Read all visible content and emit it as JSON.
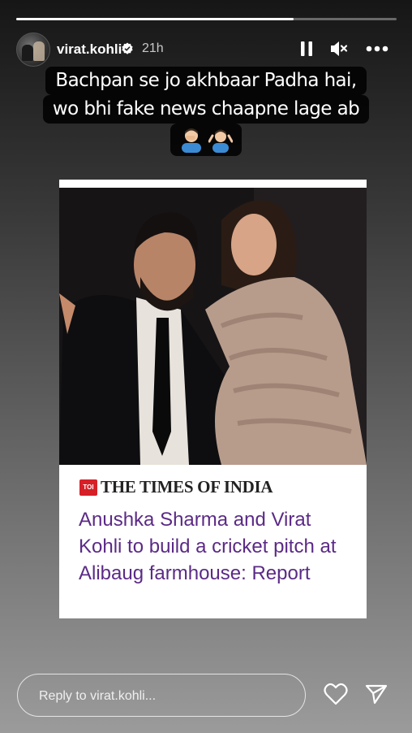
{
  "progress": {
    "viewed_fraction": 0.73
  },
  "header": {
    "username": "virat.kohli",
    "time": "21h",
    "icons": {
      "pause": "pause-icon",
      "mute": "muted-speaker-icon",
      "more": "more-dots-icon",
      "verified": "verified-badge-icon"
    }
  },
  "caption": {
    "line1": "Bachpan se jo akhbaar Padha hai,",
    "line2": "wo bhi fake news chaapne lage ab",
    "emojis": [
      "man-facepalming-emoji",
      "man-shrugging-emoji"
    ]
  },
  "card": {
    "logo_text": "TOI",
    "publication": "THE TIMES OF INDIA",
    "headline": "Anushka Sharma and Virat Kohli to build a cricket pitch at Alibaug farmhouse: Report",
    "headline_color": "#5b2a86"
  },
  "reply": {
    "placeholder": "Reply to virat.kohli..."
  },
  "actions": {
    "like": "heart-icon",
    "share": "send-icon"
  }
}
